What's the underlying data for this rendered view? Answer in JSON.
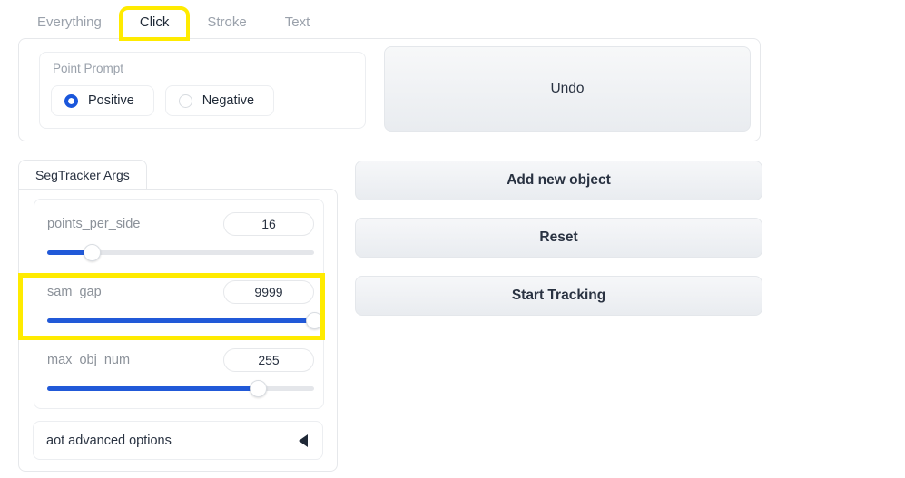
{
  "tabs": [
    {
      "label": "Everything",
      "active": false,
      "highlighted": false
    },
    {
      "label": "Click",
      "active": true,
      "highlighted": true
    },
    {
      "label": "Stroke",
      "active": false,
      "highlighted": false
    },
    {
      "label": "Text",
      "active": false,
      "highlighted": false
    }
  ],
  "point_prompt": {
    "label": "Point Prompt",
    "options": [
      {
        "label": "Positive",
        "selected": true
      },
      {
        "label": "Negative",
        "selected": false
      }
    ]
  },
  "undo": {
    "label": "Undo"
  },
  "segtracker": {
    "tab_label": "SegTracker Args",
    "sliders": [
      {
        "name": "points_per_side",
        "value": "16",
        "percent": 17,
        "highlighted": false
      },
      {
        "name": "sam_gap",
        "value": "9999",
        "percent": 100,
        "highlighted": true
      },
      {
        "name": "max_obj_num",
        "value": "255",
        "percent": 79,
        "highlighted": false
      }
    ],
    "accordion": {
      "label": "aot advanced options",
      "arrow": "triangle-left-icon",
      "expanded": false
    }
  },
  "actions": [
    {
      "label": "Add new object"
    },
    {
      "label": "Reset"
    },
    {
      "label": "Start Tracking"
    }
  ],
  "colors": {
    "accent_blue": "#2159d8",
    "radio_blue": "#1a56db",
    "highlight_yellow": "#ffeb00",
    "text_dark": "#293241",
    "text_muted": "#9aa1ab",
    "border": "#e6e8eb"
  }
}
